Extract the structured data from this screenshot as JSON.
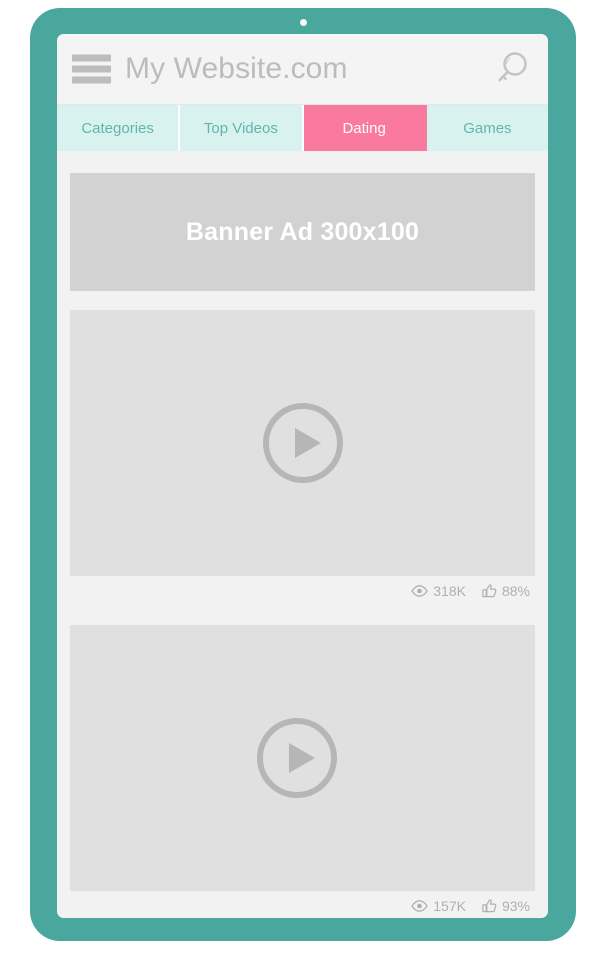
{
  "device": {
    "frame_color": "#4aa79e",
    "camera_dot_color": "#f7f7f7"
  },
  "header": {
    "menu_icon": "hamburger-icon",
    "title": "My Website.com",
    "search_icon": "search-icon",
    "background": "#f4f4f4",
    "title_color": "#bcbcbc"
  },
  "tabs": {
    "background": "#d8f3ef",
    "text_color": "#62b5ac",
    "active_background": "#f97a9e",
    "active_text_color": "#ffffff",
    "items": [
      {
        "label": "Categories",
        "active": false
      },
      {
        "label": "Top Videos",
        "active": false
      },
      {
        "label": "Dating",
        "active": true
      },
      {
        "label": "Games",
        "active": false
      }
    ]
  },
  "banner_ad": {
    "label": "Banner Ad 300x100",
    "background": "#d2d2d2",
    "text_color": "#ffffff"
  },
  "videos": [
    {
      "play_icon": "play-icon",
      "views_icon": "eye-icon",
      "views": "318K",
      "likes_icon": "thumbs-up-icon",
      "likes": "88%"
    },
    {
      "play_icon": "play-icon",
      "views_icon": "eye-icon",
      "views": "157K",
      "likes_icon": "thumbs-up-icon",
      "likes": "93%"
    }
  ]
}
